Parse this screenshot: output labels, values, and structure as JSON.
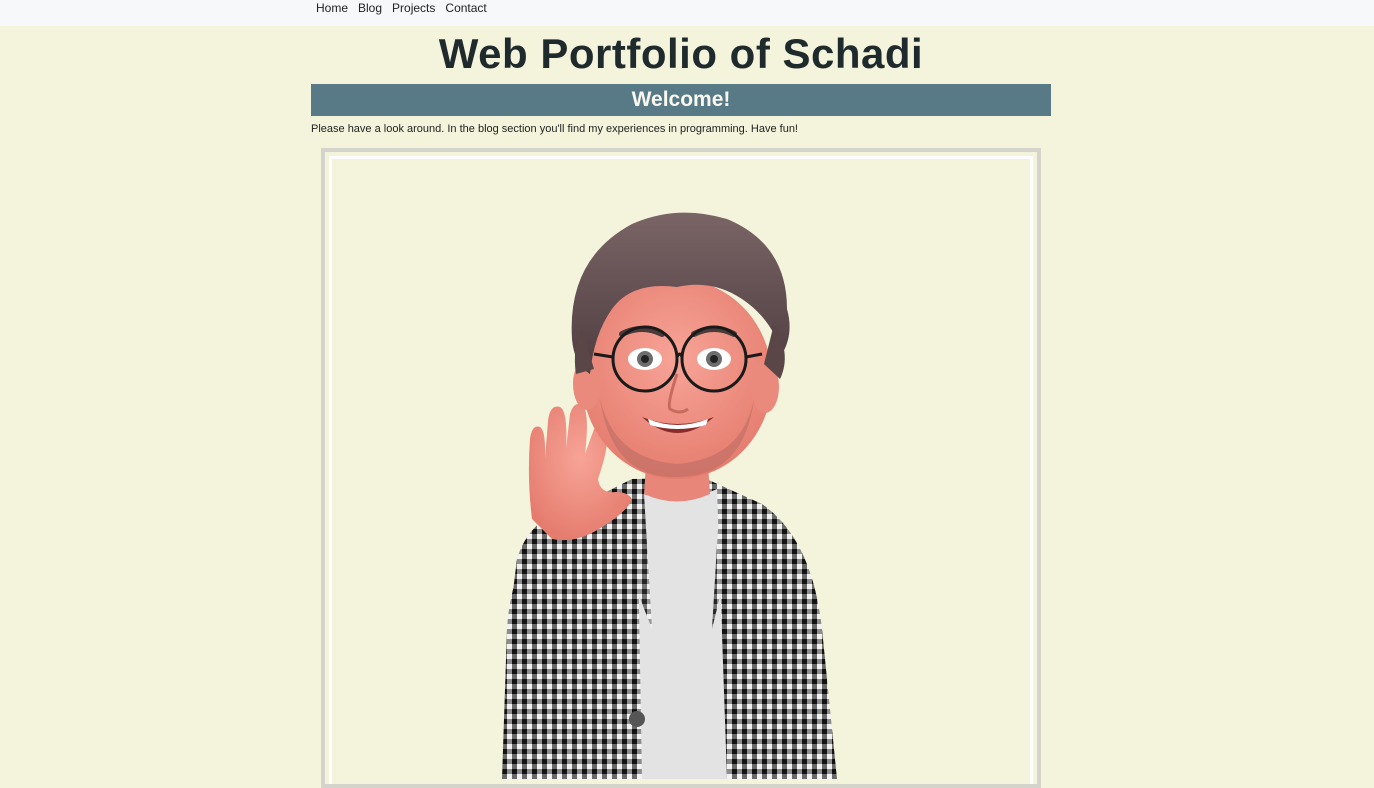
{
  "nav": {
    "items": [
      {
        "label": "Home"
      },
      {
        "label": "Blog"
      },
      {
        "label": "Projects"
      },
      {
        "label": "Contact"
      }
    ]
  },
  "header": {
    "title": "Web Portfolio of Schadi"
  },
  "welcome": {
    "heading": "Welcome!",
    "text": "Please have a look around. In the blog section you'll find my experiences in programming. Have fun!"
  },
  "colors": {
    "page_background": "#f4f4dc",
    "nav_background": "#f7f8fa",
    "welcome_bar": "#587a86",
    "title_text": "#1f2a2c"
  },
  "image": {
    "subject": "waving-avatar-icon"
  }
}
